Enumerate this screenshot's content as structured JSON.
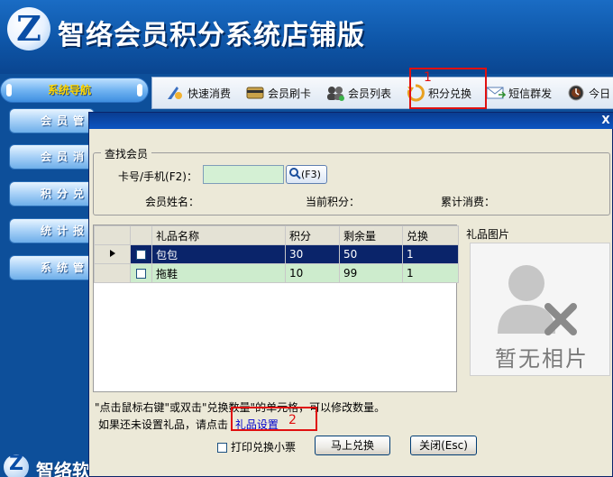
{
  "header": {
    "app_title": "智络会员积分系统店铺版",
    "logo_glyph": "Z"
  },
  "toolbar": {
    "items": [
      {
        "label": "快速消费",
        "icon": "fast-pay-icon"
      },
      {
        "label": "会员刷卡",
        "icon": "card-icon"
      },
      {
        "label": "会员列表",
        "icon": "members-icon"
      },
      {
        "label": "积分兑换",
        "icon": "exchange-icon"
      },
      {
        "label": "短信群发",
        "icon": "sms-icon"
      },
      {
        "label": "今日",
        "icon": "clock-icon"
      }
    ]
  },
  "nav": {
    "header": "系统导航",
    "items": [
      "会员管",
      "会员消",
      "积分兑",
      "统计报",
      "系统管"
    ],
    "footer_brand": "智络软件",
    "footer_glyph": "Z"
  },
  "dialog": {
    "close_glyph": "X",
    "group_title": "查找会员",
    "card_label": "卡号/手机(F2)：",
    "card_value": "",
    "search_btn": "(F3)",
    "member_name_label": "会员姓名：",
    "points_label": "当前积分：",
    "total_spend_label": "累计消费：",
    "columns": [
      "礼品名称",
      "积分",
      "剩余量",
      "兑换"
    ],
    "rows": [
      {
        "name": "包包",
        "points": "30",
        "remaining": "50",
        "exchange": "1"
      },
      {
        "name": "拖鞋",
        "points": "10",
        "remaining": "99",
        "exchange": "1"
      }
    ],
    "photo_group_title": "礼品图片",
    "no_photo_text": "暂无相片",
    "hint_text": "\"点击鼠标右键\"或双击\"兑换数量\"的单元格，可以修改数量。",
    "setup_prefix": "如果还未设置礼品，请点击",
    "setup_link": "礼品设置",
    "print_label": "打印兑换小票",
    "redeem_btn": "马上兑换",
    "close_btn": "关闭(Esc)"
  },
  "annotations": {
    "marker_1": "1",
    "marker_2": "2"
  },
  "colors": {
    "annotation_red": "#e01010",
    "selected_row": "#0a246a",
    "alt_row": "#cdeccd",
    "input_bg": "#d4f0d4"
  }
}
